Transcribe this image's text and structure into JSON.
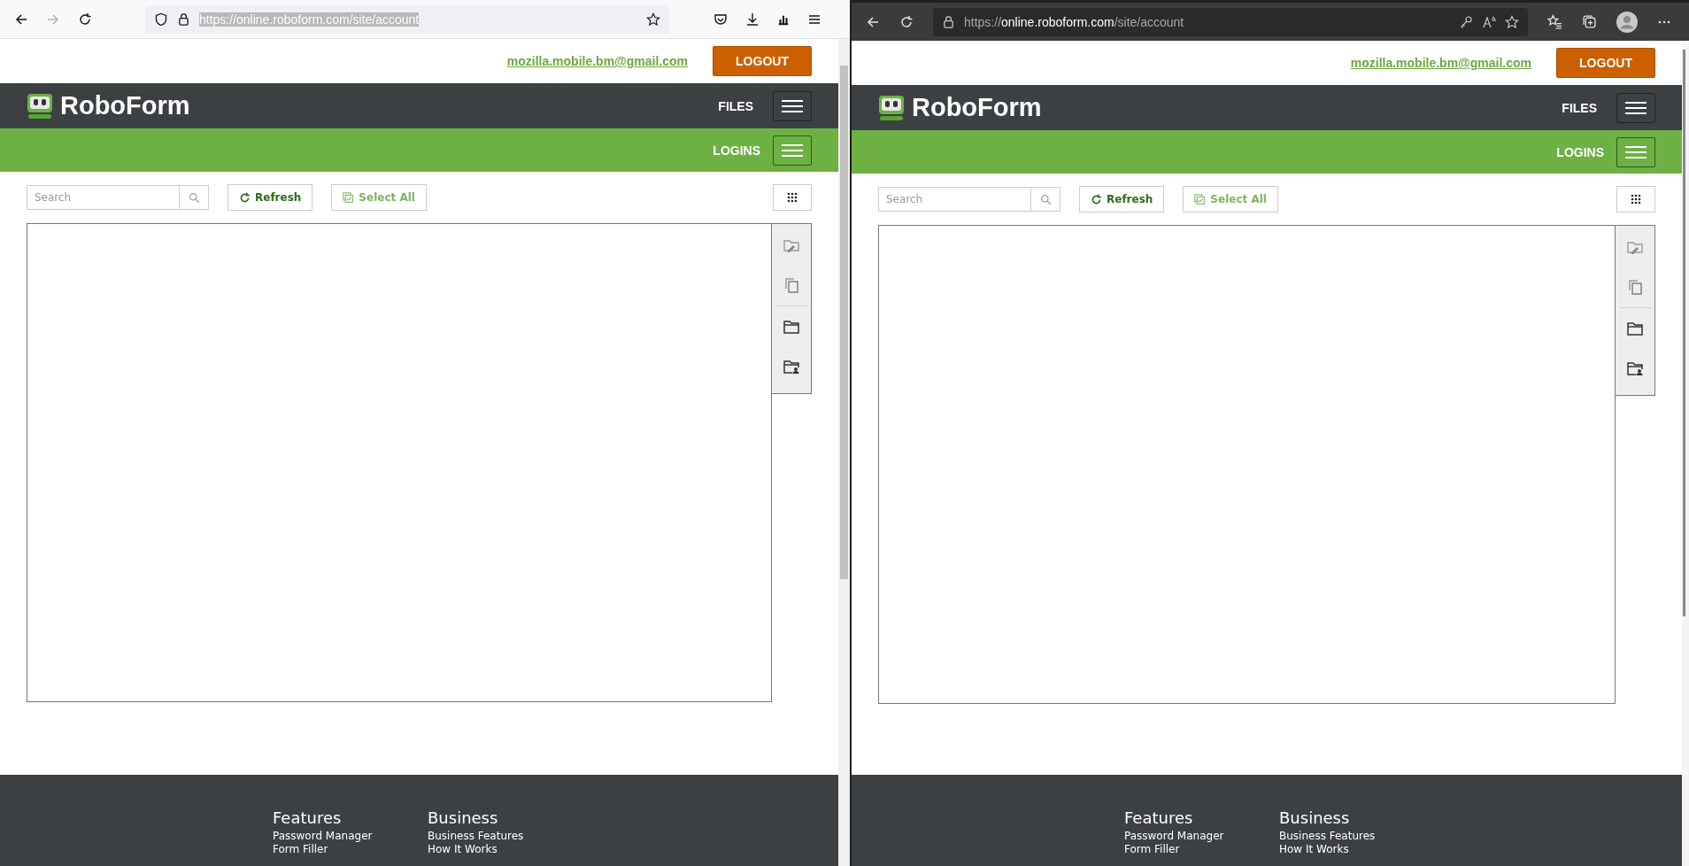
{
  "windows": [
    {
      "kind": "firefox",
      "address": {
        "text": "https://online.roboform.com/site/account",
        "selected": true
      },
      "page": {
        "email": "mozilla.mobile.bm@gmail.com",
        "logout": "LOGOUT",
        "logo": "RoboForm",
        "nav": "FILES",
        "subnav": "LOGINS",
        "search": {
          "placeholder": "Search"
        },
        "actions": [
          {
            "label": "Refresh",
            "disabled": false
          },
          {
            "label": "Select All",
            "disabled": true
          }
        ],
        "footer": [
          {
            "title": "Features",
            "links": [
              "Password Manager",
              "Form Filler"
            ]
          },
          {
            "title": "Business",
            "links": [
              "Business Features",
              "How It Works"
            ]
          }
        ]
      }
    },
    {
      "kind": "edge",
      "address": {
        "text": "https://**online.roboform.com**/site/account",
        "selected": false
      },
      "page": {
        "email": "mozilla.mobile.bm@gmail.com",
        "logout": "LOGOUT",
        "logo": "RoboForm",
        "nav": "FILES",
        "subnav": "LOGINS",
        "search": {
          "placeholder": "Search"
        },
        "actions": [
          {
            "label": "Refresh",
            "disabled": false
          },
          {
            "label": "Select All",
            "disabled": true
          }
        ],
        "footer": [
          {
            "title": "Features",
            "links": [
              "Password Manager",
              "Form Filler"
            ]
          },
          {
            "title": "Business",
            "links": [
              "Business Features",
              "How It Works"
            ]
          }
        ]
      }
    }
  ]
}
